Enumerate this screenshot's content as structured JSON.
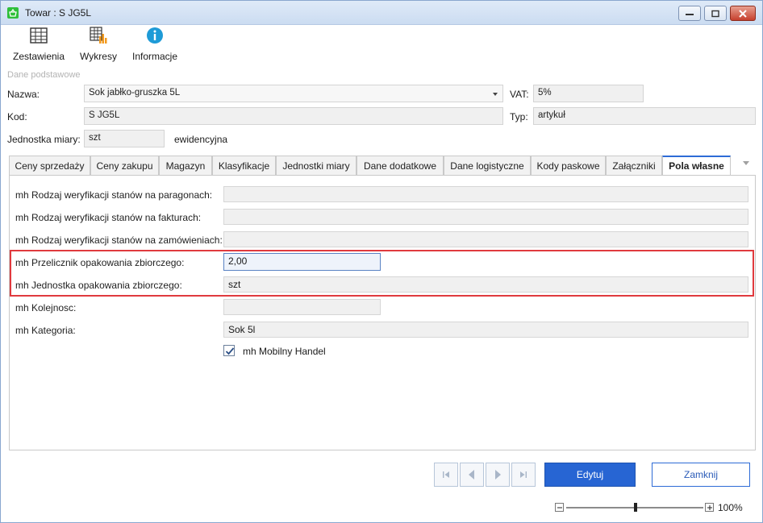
{
  "window": {
    "title": "Towar : S JG5L"
  },
  "toolbar": {
    "items": [
      {
        "label": "Zestawienia",
        "icon": "table-icon"
      },
      {
        "label": "Wykresy",
        "icon": "chart-table-icon"
      },
      {
        "label": "Informacje",
        "icon": "info-icon"
      }
    ]
  },
  "basic": {
    "section_label": "Dane podstawowe",
    "nazwa_label": "Nazwa:",
    "nazwa_value": "Sok jabłko-gruszka 5L",
    "vat_label": "VAT:",
    "vat_value": "5%",
    "kod_label": "Kod:",
    "kod_value": "S JG5L",
    "typ_label": "Typ:",
    "typ_value": "artykuł",
    "jm_label": "Jednostka miary:",
    "jm_value": "szt",
    "jm_suffix": "ewidencyjna"
  },
  "tabs": [
    {
      "label": "Ceny sprzedaży"
    },
    {
      "label": "Ceny zakupu"
    },
    {
      "label": "Magazyn"
    },
    {
      "label": "Klasyfikacje"
    },
    {
      "label": "Jednostki miary"
    },
    {
      "label": "Dane dodatkowe"
    },
    {
      "label": "Dane logistyczne"
    },
    {
      "label": "Kody paskowe"
    },
    {
      "label": "Załączniki"
    },
    {
      "label": "Pola własne"
    }
  ],
  "custom_fields": [
    {
      "label": "mh Rodzaj weryfikacji stanów na paragonach:",
      "value": ""
    },
    {
      "label": "mh Rodzaj weryfikacji stanów na fakturach:",
      "value": ""
    },
    {
      "label": "mh Rodzaj weryfikacji stanów na zamówieniach:",
      "value": ""
    },
    {
      "label": "mh Przelicznik opakowania zbiorczego:",
      "value": "2,00"
    },
    {
      "label": "mh Jednostka opakowania zbiorczego:",
      "value": "szt"
    },
    {
      "label": "mh Kolejnosc:",
      "value": ""
    },
    {
      "label": "mh Kategoria:",
      "value": "Sok 5l"
    }
  ],
  "checkbox": {
    "label": "mh Mobilny Handel",
    "checked": true
  },
  "buttons": {
    "edit": "Edytuj",
    "close": "Zamknij"
  },
  "zoom": {
    "value": "100%"
  },
  "colors": {
    "accent": "#2765d3",
    "highlight": "#e03a3e"
  }
}
